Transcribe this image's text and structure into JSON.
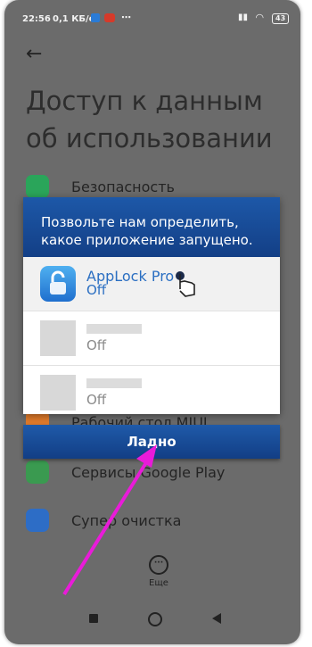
{
  "status": {
    "time": "22:56",
    "network_speed": "0,1 КБ/с",
    "more": "⋯",
    "battery": "43"
  },
  "header": {
    "title": "Доступ к данным об использовании"
  },
  "apps": [
    {
      "label": "Безопасность",
      "color": "#2aa55a"
    },
    {
      "label": "Рабочий стол MIUI",
      "color": "#e07a2a"
    },
    {
      "label": "Сервисы Google Play",
      "color": "#3a9a50"
    },
    {
      "label": "Супер очистка",
      "color": "#2d6dc6"
    }
  ],
  "dialog": {
    "message": "Позвольте нам определить, какое приложение запущено.",
    "items": [
      {
        "name": "AppLock Pro",
        "state": "Off"
      },
      {
        "name": "",
        "state": "Off"
      },
      {
        "name": "",
        "state": "Off"
      }
    ],
    "ok_label": "Ладно"
  },
  "more_label": "Еще",
  "accent_colors": {
    "dialog_blue": "#1d58a8",
    "arrow_magenta": "#e91bd9",
    "link_blue": "#2b6fc2"
  }
}
